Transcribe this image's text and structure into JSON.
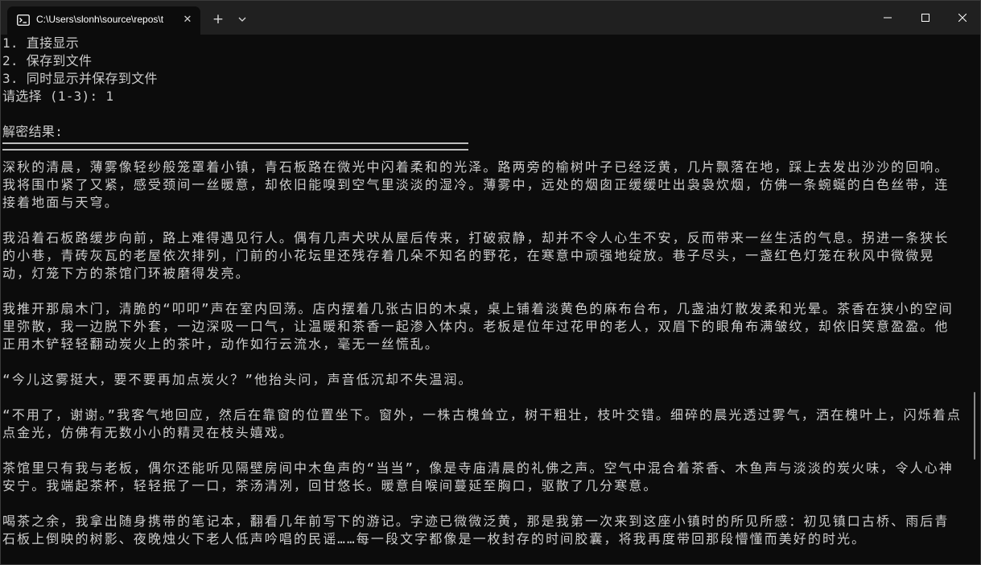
{
  "window": {
    "tab_title": "C:\\Users\\slonh\\source\\repos\\t",
    "tab_icon": "terminal-icon",
    "new_tab_label": "+",
    "close_tab_label": "✕"
  },
  "console": {
    "menu": [
      "1. 直接显示",
      "2. 保存到文件",
      "3. 同时显示并保存到文件"
    ],
    "prompt": "请选择 (1-3): 1",
    "result_heading": "解密结果:",
    "paragraphs": [
      "深秋的清晨，薄雾像轻纱般笼罩着小镇，青石板路在微光中闪着柔和的光泽。路两旁的榆树叶子已经泛黄，几片飘落在地，踩上去发出沙沙的回响。我将围巾紧了又紧，感受颈间一丝暖意，却依旧能嗅到空气里淡淡的湿冷。薄雾中，远处的烟囱正缓缓吐出袅袅炊烟，仿佛一条蜿蜒的白色丝带，连接着地面与天穹。",
      "我沿着石板路缓步向前，路上难得遇见行人。偶有几声犬吠从屋后传来，打破寂静，却并不令人心生不安，反而带来一丝生活的气息。拐进一条狭长的小巷，青砖灰瓦的老屋依次排列，门前的小花坛里还残存着几朵不知名的野花，在寒意中顽强地绽放。巷子尽头，一盏红色灯笼在秋风中微微晃动，灯笼下方的茶馆门环被磨得发亮。",
      "我推开那扇木门，清脆的“叩叩”声在室内回荡。店内摆着几张古旧的木桌，桌上铺着淡黄色的麻布台布，几盏油灯散发柔和光晕。茶香在狭小的空间里弥散，我一边脱下外套，一边深吸一口气，让温暖和茶香一起渗入体内。老板是位年过花甲的老人，双眉下的眼角布满皱纹，却依旧笑意盈盈。他正用木铲轻轻翻动炭火上的茶叶，动作如行云流水，毫无一丝慌乱。",
      "“今儿这雾挺大，要不要再加点炭火？”他抬头问，声音低沉却不失温润。",
      "“不用了，谢谢。”我客气地回应，然后在靠窗的位置坐下。窗外，一株古槐耸立，树干粗壮，枝叶交错。细碎的晨光透过雾气，洒在槐叶上，闪烁着点点金光，仿佛有无数小小的精灵在枝头嬉戏。",
      "茶馆里只有我与老板，偶尔还能听见隔壁房间中木鱼声的“当当”，像是寺庙清晨的礼佛之声。空气中混合着茶香、木鱼声与淡淡的炭火味，令人心神安宁。我端起茶杯，轻轻抿了一口，茶汤清冽，回甘悠长。暖意自喉间蔓延至胸口，驱散了几分寒意。",
      "喝茶之余，我拿出随身携带的笔记本，翻看几年前写下的游记。字迹已微微泛黄，那是我第一次来到这座小镇时的所见所感：初见镇口古桥、雨后青石板上倒映的树影、夜晚烛火下老人低声吟唱的民谣……每一段文字都像是一枚封存的时间胶囊，将我再度带回那段懵懂而美好的时光。"
    ]
  }
}
